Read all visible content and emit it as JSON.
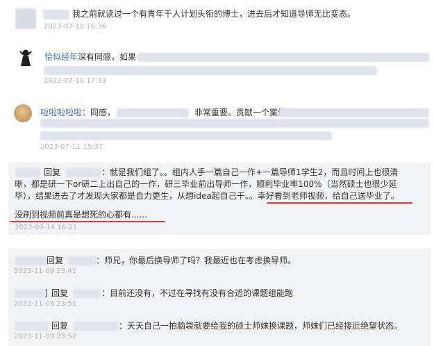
{
  "comments": [
    {
      "text": "我之前就读过一个有青年千人计划头衔的博士，进去后才知道导师无比变态。",
      "time": "2023-07-10 16:36"
    },
    {
      "author": "恰似经年",
      "text": "深有同感，如果",
      "time": "2023-07-10 17:33"
    },
    {
      "author": "啦啦啦啦啦",
      "text_a": "同感，",
      "text_b": "非常重要。贡献一个案例。",
      "time": "2023-07-11 15:37"
    }
  ],
  "reply_panel_1": {
    "reply_word": "回复",
    "line1": "：就是我们组了。。组内人手一篇自己一作+一篇导师1学生2，而且时间上也很清",
    "line2": "晰，都是研一下or研二上出自己的一作，研三毕业前出导师一作，顺利毕业率100%（当然硕士也很少延",
    "line3_a": "毕），结果进去了才发现大家都是自力更生，从想idea起自己干。。",
    "line3_b": "幸好看到老师视频，给自己送毕业了。",
    "line4": "没刷到视频前真是想死的心都有......",
    "time": "2023-09-14 16:21"
  },
  "reply_panel_2": [
    {
      "reply_word": "回复",
      "text": "：师兄，你最后换导师了吗？我最近也在考虑换导师。",
      "time": "2023-11-09 23:41"
    },
    {
      "reply_word": "回复",
      "prefix": "]",
      "text": "：目前还没有，不过在寻找有没有合适的课题组能跑",
      "time": "2023-11-09 23:51"
    },
    {
      "reply_word": "回复",
      "text": "：天天自己一拍脑袋就要给我的硕士师妹换课题，师妹们已经接近绝望状态。",
      "time": "2023-11-09 23:52"
    }
  ],
  "colors": {
    "author": "#4a6ea9",
    "underline": "#e53935",
    "panel": "#f2f3f5"
  }
}
